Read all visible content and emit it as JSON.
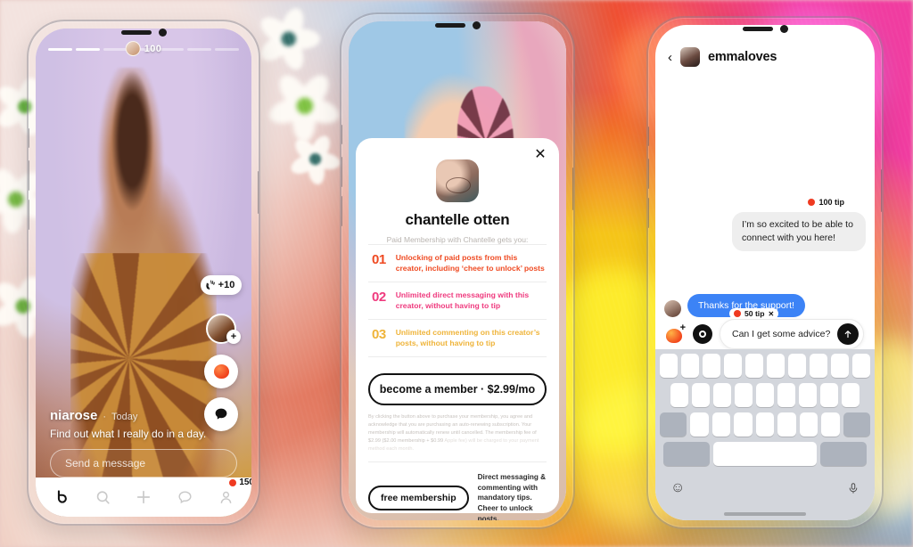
{
  "app": {
    "name": "Cheer social app mockup"
  },
  "background": {
    "description": "blurred floral abstract",
    "colors": [
      "#f5c518",
      "#ef4e2e",
      "#f03ca0",
      "#8fb7e6",
      "#f0dcd6"
    ]
  },
  "phone_story": {
    "status_badge": {
      "count": "100"
    },
    "progress": {
      "segments": 7,
      "completed": 2
    },
    "actions": {
      "clap_label": "+10",
      "avatar_plus": "+",
      "tomato_icon": "tomato-icon",
      "comment_icon": "comment-icon"
    },
    "footer": {
      "username": "niarose",
      "separator": "·",
      "time": "Today",
      "caption": "Find out what I really do in a day.",
      "input_placeholder": "Send a message"
    },
    "tabbar": {
      "items": [
        {
          "name": "home",
          "icon": "logo-icon"
        },
        {
          "name": "search",
          "icon": "search-icon"
        },
        {
          "name": "create",
          "icon": "plus-icon"
        },
        {
          "name": "messages",
          "icon": "comment-icon"
        },
        {
          "name": "profile",
          "icon": "person-icon"
        }
      ],
      "profile_badge": "150"
    }
  },
  "phone_membership": {
    "close_label": "✕",
    "creator_name": "chantelle otten",
    "subtitle": "Paid Membership with Chantelle gets you:",
    "perks": [
      {
        "num": "01",
        "color": "#ef4a22",
        "text": "Unlocking of paid posts from this creator, including ‘cheer to unlock’ posts"
      },
      {
        "num": "02",
        "color": "#ef3a7e",
        "text": "Unlimited direct messaging with this creator, without having to tip"
      },
      {
        "num": "03",
        "color": "#efb43a",
        "text": "Unlimited commenting on this creator’s posts, without having to tip"
      }
    ],
    "cta_label": "become a member  ·  $2.99/mo",
    "legal": "By clicking the button above to purchase your membership, you agree and acknowledge that you are purchasing an auto-renewing subscription. Your membership will automatically renew until cancelled. The membership fee of $2.99 ($2.00 membership + $0.99 ",
    "legal_faded": "Apple fee) will be charged to your payment method each month.",
    "free_button_label": "free membership",
    "free_description": "Direct messaging & commenting with mandatory tips. Cheer to unlock posts."
  },
  "phone_chat": {
    "header": {
      "back_icon": "chevron-left-icon",
      "username": "emmaloves"
    },
    "messages": [
      {
        "direction": "incoming",
        "tip": "100 tip",
        "text": "I’m so excited to be able to connect with you here!"
      },
      {
        "direction": "outgoing",
        "text": "Thanks for the support!"
      }
    ],
    "composer": {
      "media_icon": "media-plus-icon",
      "camera_icon": "camera-icon",
      "tip_chip": "50 tip",
      "tip_chip_remove": "✕",
      "input_value": "Can I get some advice?",
      "send_icon": "arrow-up-icon"
    },
    "keyboard": {
      "emoji_icon": "emoji-icon",
      "mic_icon": "microphone-icon",
      "rows": [
        10,
        9,
        7,
        3
      ]
    }
  }
}
